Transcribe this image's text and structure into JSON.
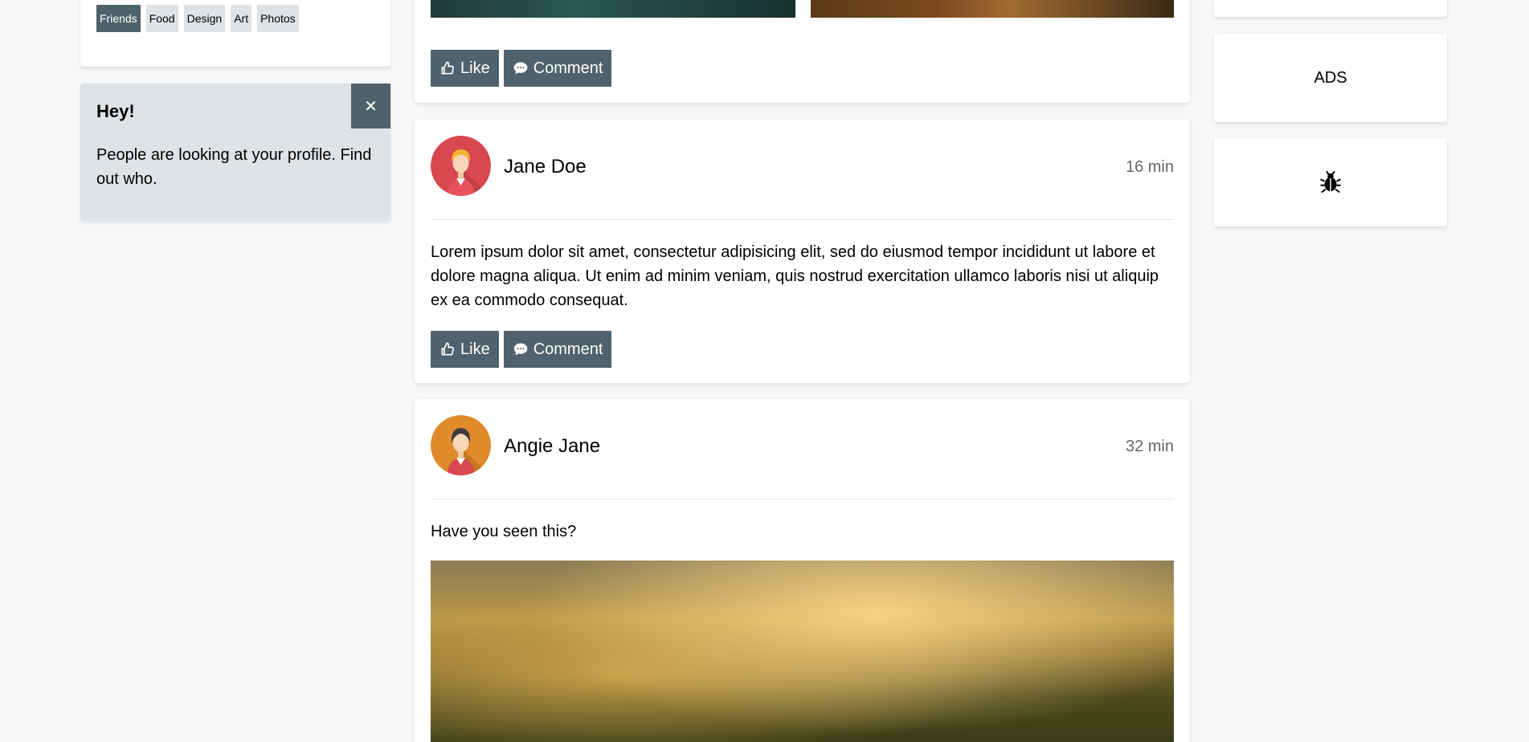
{
  "tags": [
    "Friends",
    "Food",
    "Design",
    "Art",
    "Photos"
  ],
  "active_tag": "Friends",
  "notice": {
    "title": "Hey!",
    "message": "People are looking at your profile. Find out who.",
    "close_glyph": "✕"
  },
  "actions": {
    "like_label": "Like",
    "comment_label": "Comment"
  },
  "posts": [
    {
      "author": "Jane Doe",
      "time": "16 min",
      "text": "Lorem ipsum dolor sit amet, consectetur adipisicing elit, sed do eiusmod tempor incididunt ut labore et dolore magna aliqua. Ut enim ad minim veniam, quis nostrud exercitation ullamco laboris nisi ut aliquip ex ea commodo consequat."
    },
    {
      "author": "Angie Jane",
      "time": "32 min",
      "text": "Have you seen this?"
    }
  ],
  "sidebar": {
    "ads_label": "ADS",
    "bug_icon": "bug-icon"
  },
  "colors": {
    "accent": "#4f626d",
    "tag_bg": "#dfe3e6",
    "page_bg": "#f5f7f8",
    "avatar_jane_bg": "#d9474f",
    "avatar_angie_bg": "#e08a2b"
  }
}
